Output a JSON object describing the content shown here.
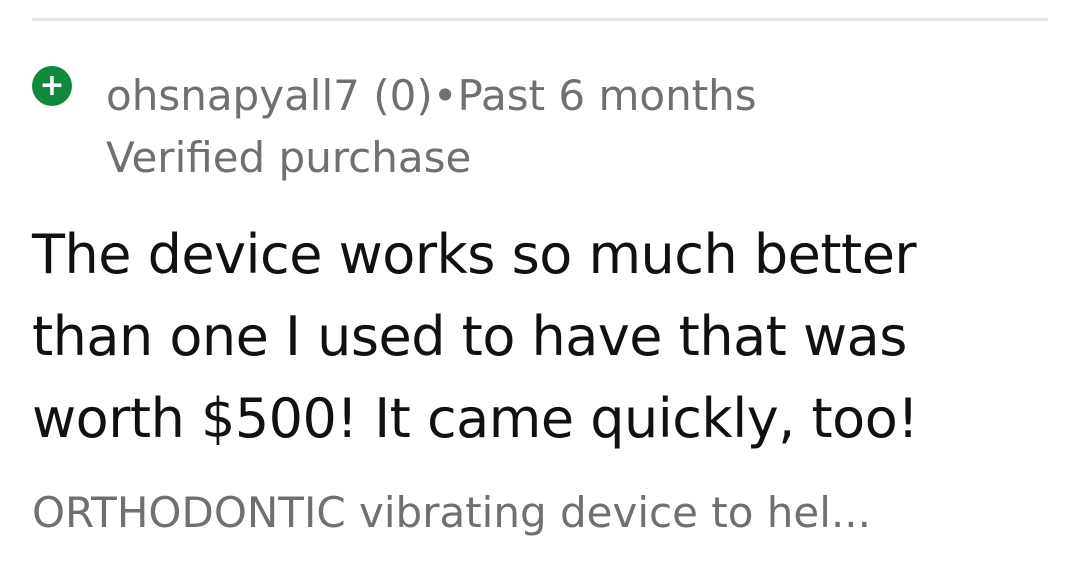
{
  "review": {
    "feedback_icon": "plus-icon",
    "feedback_icon_glyph": "+",
    "feedback_color": "#0f8a3b",
    "username": "ohsnapyall7",
    "rating_count": "(0)",
    "separator": "•",
    "time_ago": "Past 6 months",
    "verified_label": "Verified purchase",
    "body_lines": [
      "The device works so much better",
      "than one I used to have that was",
      "worth $500! It came quickly, too!"
    ],
    "product_title": "ORTHODONTIC vibrating device to hel..."
  }
}
